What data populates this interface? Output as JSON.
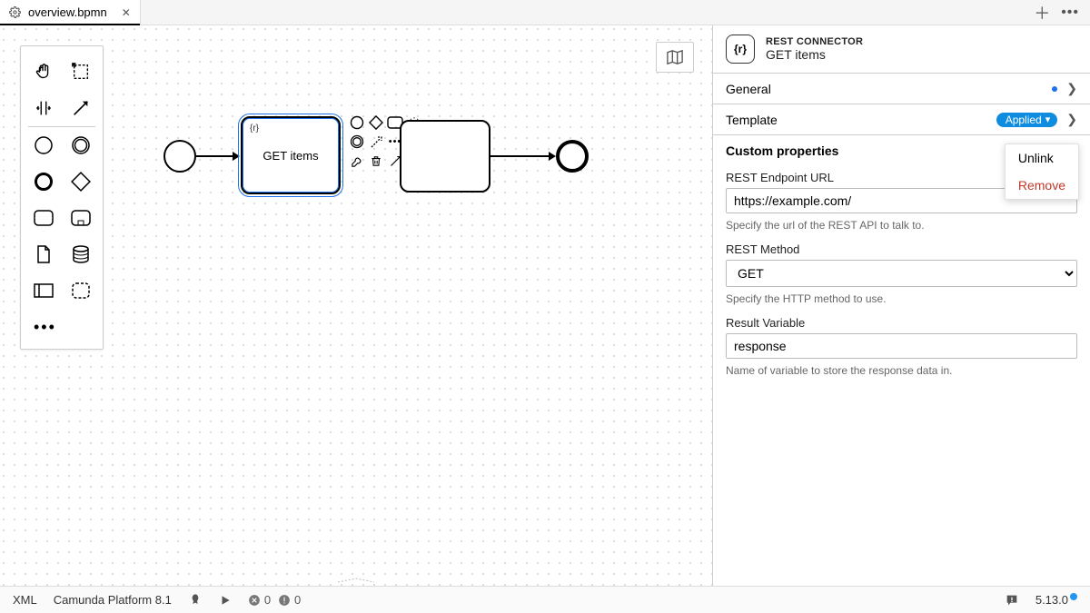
{
  "tab": {
    "filename": "overview.bpmn"
  },
  "diagram": {
    "selected_task_label": "GET items"
  },
  "props": {
    "header_type": "REST CONNECTOR",
    "header_name": "GET items",
    "groups": {
      "general_label": "General",
      "template_label": "Template",
      "template_status": "Applied",
      "custom_label": "Custom properties"
    },
    "dropdown": {
      "unlink": "Unlink",
      "remove": "Remove"
    },
    "fields": {
      "endpoint_label": "REST Endpoint URL",
      "endpoint_value": "https://example.com/",
      "endpoint_desc": "Specify the url of the REST API to talk to.",
      "method_label": "REST Method",
      "method_value": "GET",
      "method_desc": "Specify the HTTP method to use.",
      "result_label": "Result Variable",
      "result_value": "response",
      "result_desc": "Name of variable to store the response data in."
    }
  },
  "status": {
    "xml": "XML",
    "platform": "Camunda Platform 8.1",
    "errors": "0",
    "warnings": "0",
    "version": "5.13.0"
  }
}
